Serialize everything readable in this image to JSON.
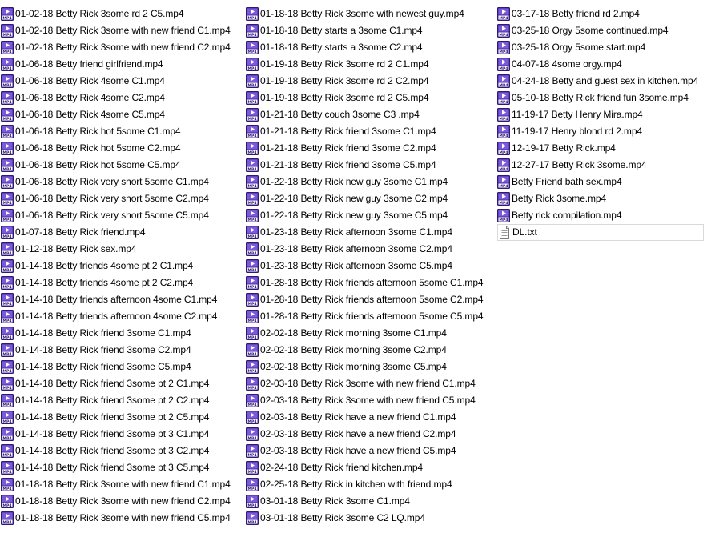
{
  "icons": {
    "video": "mp4-file-icon",
    "text": "text-file-icon"
  },
  "colors": {
    "mp4_icon": "#4a2aa8",
    "mp4_icon_light": "#7a5ad8"
  },
  "columns": [
    [
      {
        "name": "01-02-18 Betty Rick 3some rd 2 C5.mp4",
        "type": "video"
      },
      {
        "name": "01-02-18 Betty Rick 3some with new friend C1.mp4",
        "type": "video"
      },
      {
        "name": "01-02-18 Betty Rick 3some with new friend C2.mp4",
        "type": "video"
      },
      {
        "name": "01-06-18 Betty friend girlfriend.mp4",
        "type": "video"
      },
      {
        "name": "01-06-18 Betty Rick 4some C1.mp4",
        "type": "video"
      },
      {
        "name": "01-06-18 Betty Rick 4some C2.mp4",
        "type": "video"
      },
      {
        "name": "01-06-18 Betty Rick 4some C5.mp4",
        "type": "video"
      },
      {
        "name": "01-06-18 Betty Rick hot 5some C1.mp4",
        "type": "video"
      },
      {
        "name": "01-06-18 Betty Rick hot 5some C2.mp4",
        "type": "video"
      },
      {
        "name": "01-06-18 Betty Rick hot 5some C5.mp4",
        "type": "video"
      },
      {
        "name": "01-06-18 Betty Rick very short 5some C1.mp4",
        "type": "video"
      },
      {
        "name": "01-06-18 Betty Rick very short 5some C2.mp4",
        "type": "video"
      },
      {
        "name": "01-06-18 Betty Rick very short 5some C5.mp4",
        "type": "video"
      },
      {
        "name": "01-07-18 Betty Rick friend.mp4",
        "type": "video"
      },
      {
        "name": "01-12-18 Betty Rick sex.mp4",
        "type": "video"
      },
      {
        "name": "01-14-18 Betty friends 4some pt 2 C1.mp4",
        "type": "video"
      },
      {
        "name": "01-14-18 Betty friends 4some pt 2 C2.mp4",
        "type": "video"
      },
      {
        "name": "01-14-18 Betty friends afternoon 4some C1.mp4",
        "type": "video"
      },
      {
        "name": "01-14-18 Betty friends afternoon 4some C2.mp4",
        "type": "video"
      },
      {
        "name": "01-14-18 Betty Rick friend 3some C1.mp4",
        "type": "video"
      },
      {
        "name": "01-14-18 Betty Rick friend 3some C2.mp4",
        "type": "video"
      },
      {
        "name": "01-14-18 Betty Rick friend 3some C5.mp4",
        "type": "video"
      },
      {
        "name": "01-14-18 Betty Rick friend 3some pt 2 C1.mp4",
        "type": "video"
      },
      {
        "name": "01-14-18 Betty Rick friend 3some pt 2 C2.mp4",
        "type": "video"
      },
      {
        "name": "01-14-18 Betty Rick friend 3some pt 2 C5.mp4",
        "type": "video"
      },
      {
        "name": "01-14-18 Betty Rick friend 3some pt 3 C1.mp4",
        "type": "video"
      },
      {
        "name": "01-14-18 Betty Rick friend 3some pt 3 C2.mp4",
        "type": "video"
      },
      {
        "name": "01-14-18 Betty Rick friend 3some pt 3 C5.mp4",
        "type": "video"
      },
      {
        "name": "01-18-18 Betty Rick 3some with new friend C1.mp4",
        "type": "video"
      },
      {
        "name": "01-18-18 Betty Rick 3some with new friend C2.mp4",
        "type": "video"
      },
      {
        "name": "01-18-18 Betty Rick 3some with new friend C5.mp4",
        "type": "video"
      }
    ],
    [
      {
        "name": "01-18-18 Betty Rick 3some with newest guy.mp4",
        "type": "video"
      },
      {
        "name": "01-18-18 Betty starts a 3some C1.mp4",
        "type": "video"
      },
      {
        "name": "01-18-18 Betty starts a 3some C2.mp4",
        "type": "video"
      },
      {
        "name": "01-19-18 Betty Rick 3some rd 2 C1.mp4",
        "type": "video"
      },
      {
        "name": "01-19-18 Betty Rick 3some rd 2 C2.mp4",
        "type": "video"
      },
      {
        "name": "01-19-18 Betty Rick 3some rd 2 C5.mp4",
        "type": "video"
      },
      {
        "name": "01-21-18 Betty couch 3some C3 .mp4",
        "type": "video"
      },
      {
        "name": "01-21-18 Betty Rick friend 3some C1.mp4",
        "type": "video"
      },
      {
        "name": "01-21-18 Betty Rick friend 3some C2.mp4",
        "type": "video"
      },
      {
        "name": "01-21-18 Betty Rick friend 3some C5.mp4",
        "type": "video"
      },
      {
        "name": "01-22-18 Betty Rick new guy 3some C1.mp4",
        "type": "video"
      },
      {
        "name": "01-22-18 Betty Rick new guy 3some C2.mp4",
        "type": "video"
      },
      {
        "name": "01-22-18 Betty Rick new guy 3some C5.mp4",
        "type": "video"
      },
      {
        "name": "01-23-18 Betty Rick afternoon 3some C1.mp4",
        "type": "video"
      },
      {
        "name": "01-23-18 Betty Rick afternoon 3some C2.mp4",
        "type": "video"
      },
      {
        "name": "01-23-18 Betty Rick afternoon 3some C5.mp4",
        "type": "video"
      },
      {
        "name": "01-28-18 Betty Rick friends afternoon 5some C1.mp4",
        "type": "video"
      },
      {
        "name": "01-28-18 Betty Rick friends afternoon 5some C2.mp4",
        "type": "video"
      },
      {
        "name": "01-28-18 Betty Rick friends afternoon 5some C5.mp4",
        "type": "video"
      },
      {
        "name": "02-02-18 Betty Rick morning 3some C1.mp4",
        "type": "video"
      },
      {
        "name": "02-02-18 Betty Rick morning 3some C2.mp4",
        "type": "video"
      },
      {
        "name": "02-02-18 Betty Rick morning 3some C5.mp4",
        "type": "video"
      },
      {
        "name": "02-03-18 Betty Rick 3some with new friend C1.mp4",
        "type": "video"
      },
      {
        "name": "02-03-18 Betty Rick 3some with new friend C5.mp4",
        "type": "video"
      },
      {
        "name": "02-03-18 Betty Rick have a new friend C1.mp4",
        "type": "video"
      },
      {
        "name": "02-03-18 Betty Rick have a new friend C2.mp4",
        "type": "video"
      },
      {
        "name": "02-03-18 Betty Rick have a new friend C5.mp4",
        "type": "video"
      },
      {
        "name": "02-24-18 Betty Rick friend kitchen.mp4",
        "type": "video"
      },
      {
        "name": "02-25-18 Betty Rick in kitchen with friend.mp4",
        "type": "video"
      },
      {
        "name": "03-01-18 Betty Rick 3some C1.mp4",
        "type": "video"
      },
      {
        "name": "03-01-18 Betty Rick 3some C2 LQ.mp4",
        "type": "video"
      }
    ],
    [
      {
        "name": "03-17-18 Betty friend rd 2.mp4",
        "type": "video"
      },
      {
        "name": "03-25-18 Orgy 5some continued.mp4",
        "type": "video"
      },
      {
        "name": "03-25-18 Orgy 5some start.mp4",
        "type": "video"
      },
      {
        "name": "04-07-18 4some orgy.mp4",
        "type": "video"
      },
      {
        "name": "04-24-18 Betty and guest sex in kitchen.mp4",
        "type": "video"
      },
      {
        "name": "05-10-18 Betty Rick friend fun 3some.mp4",
        "type": "video"
      },
      {
        "name": "11-19-17 Betty Henry Mira.mp4",
        "type": "video"
      },
      {
        "name": "11-19-17 Henry blond rd 2.mp4",
        "type": "video"
      },
      {
        "name": "12-19-17 Betty Rick.mp4",
        "type": "video"
      },
      {
        "name": "12-27-17 Betty Rick 3some.mp4",
        "type": "video"
      },
      {
        "name": "Betty Friend bath sex.mp4",
        "type": "video"
      },
      {
        "name": "Betty Rick 3some.mp4",
        "type": "video"
      },
      {
        "name": "Betty rick compilation.mp4",
        "type": "video"
      },
      {
        "name": "DL.txt",
        "type": "text",
        "selected": true
      }
    ]
  ]
}
